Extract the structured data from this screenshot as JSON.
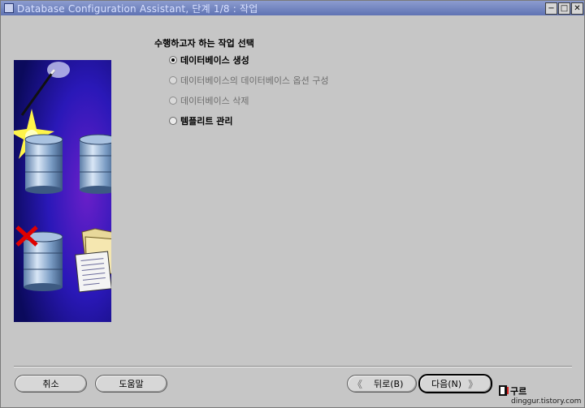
{
  "window": {
    "title": "Database Configuration Assistant, 단계 1/8 : 작업",
    "minimize": "−",
    "maximize": "□",
    "close": "✕"
  },
  "main": {
    "heading": "수행하고자 하는 작업 선택",
    "options": [
      {
        "label": "데이터베이스 생성",
        "selected": true,
        "enabled": true
      },
      {
        "label": "데이터베이스의 데이터베이스 옵션 구성",
        "selected": false,
        "enabled": false
      },
      {
        "label": "데이터베이스 삭제",
        "selected": false,
        "enabled": false
      },
      {
        "label": "템플리트 관리",
        "selected": false,
        "enabled": true
      }
    ]
  },
  "buttons": {
    "cancel": "취소",
    "help": "도움말",
    "back": "뒤로(B)",
    "next": "다음(N)"
  },
  "footer": {
    "logo_text": "구르",
    "site": "dinggur.tistory.com"
  }
}
